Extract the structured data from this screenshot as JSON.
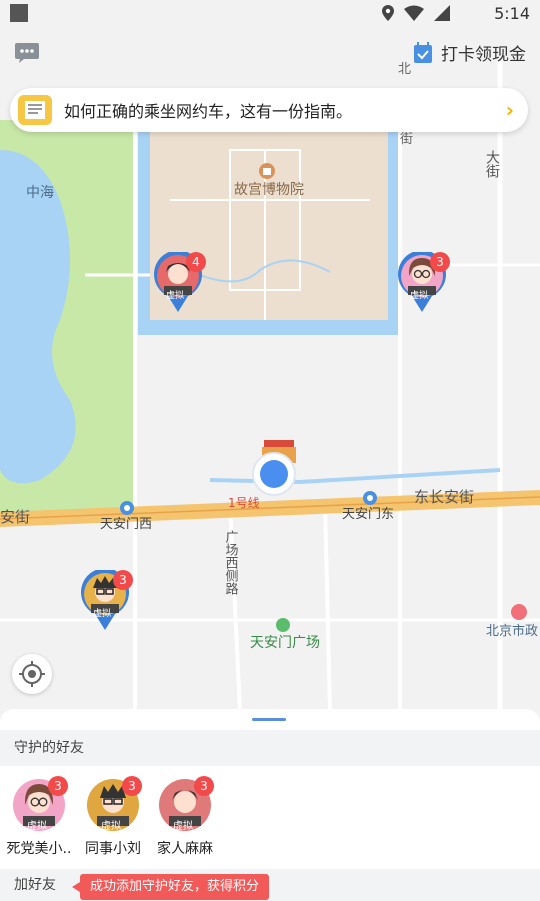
{
  "status_bar": {
    "time": "5:14"
  },
  "header": {
    "checkin_label": "打卡领现金",
    "notice_text": "如何正确的乘坐网约车，这有一份指南。"
  },
  "map": {
    "labels": {
      "zhonghai": "中海",
      "palace": "故宫博物院",
      "tiananmen_west": "天安门西",
      "tiananmen_east": "天安门东",
      "east_changan": "东长安街",
      "line1": "1号线",
      "square_west_road": "广场西侧路",
      "tiananmen_square": "天安门广场",
      "beijing_city": "北京市政",
      "an_jie": "安街",
      "street_left": "北",
      "street_mid": "街",
      "street_right": "大街"
    },
    "markers": [
      {
        "name": "marker-female-1",
        "count": "4",
        "tag": "虚拟"
      },
      {
        "name": "marker-female-glasses",
        "count": "3",
        "tag": "虚拟"
      },
      {
        "name": "marker-male-glasses",
        "count": "3",
        "tag": "虚拟"
      }
    ]
  },
  "sheet": {
    "guard_title": "守护的好友",
    "friends": [
      {
        "name": "死党美小..",
        "count": "3",
        "tag": "虚拟"
      },
      {
        "name": "同事小刘",
        "count": "3",
        "tag": "虚拟"
      },
      {
        "name": "家人麻麻",
        "count": "3",
        "tag": "虚拟"
      }
    ],
    "add_friend_label": "加好友",
    "toast": "成功添加守护好友，获得积分"
  },
  "colors": {
    "accent": "#4a90e2",
    "badge": "#f24a4a",
    "toast": "#f25959",
    "road_main": "#f5c46e",
    "water": "#a9d3f5",
    "park": "#c5e7a4"
  }
}
